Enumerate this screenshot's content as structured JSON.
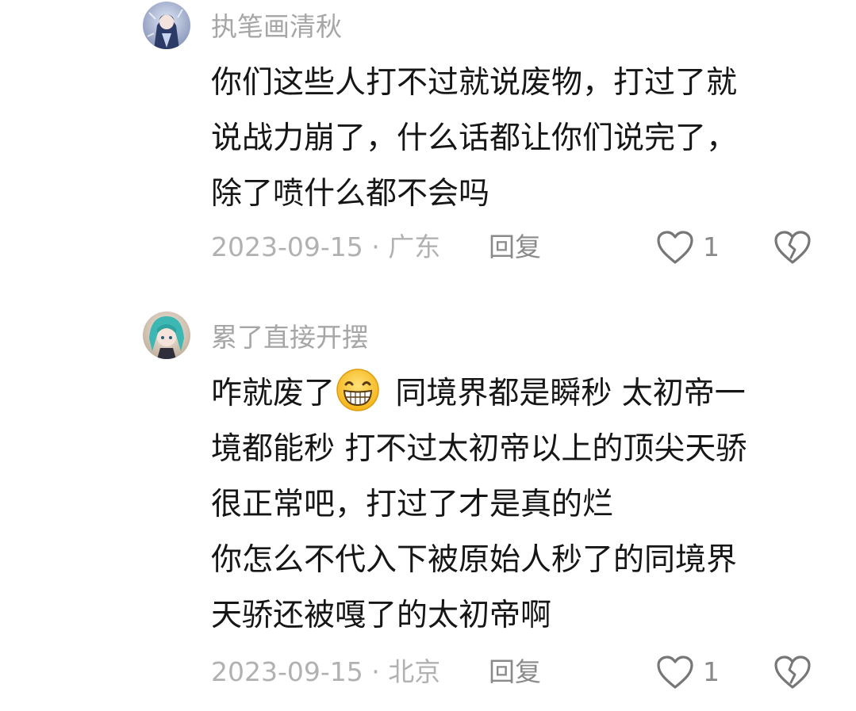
{
  "comments": [
    {
      "username": "执笔画清秋",
      "lines": [
        "你们这些人打不过就说废物，打过了就",
        "说战力崩了，什么话都让你们说完了，",
        "除了喷什么都不会吗"
      ],
      "meta": "2023-09-15 · 广东",
      "reply_label": "回复",
      "like_count": "1",
      "avatar_icon": "anime-character-avatar"
    },
    {
      "username": "累了直接开摆",
      "line1_before": "咋就废了",
      "line1_emoji": "grinning-face-emoji",
      "line1_after": " 同境界都是瞬秒 太初帝一",
      "lines": [
        "境都能秒 打不过太初帝以上的顶尖天骄",
        "很正常吧，打过了才是真的烂",
        "你怎么不代入下被原始人秒了的同境界",
        "天骄还被嘎了的太初帝啊"
      ],
      "meta": "2023-09-15 · 北京",
      "reply_label": "回复",
      "like_count": "1",
      "avatar_icon": "anime-character-avatar"
    }
  ],
  "icons": {
    "like": "heart-outline-icon",
    "dislike": "broken-heart-icon"
  },
  "colors": {
    "username": "#a6a6a6",
    "text": "#161616",
    "meta": "#b1b1b1",
    "action": "#8a8a8a"
  }
}
